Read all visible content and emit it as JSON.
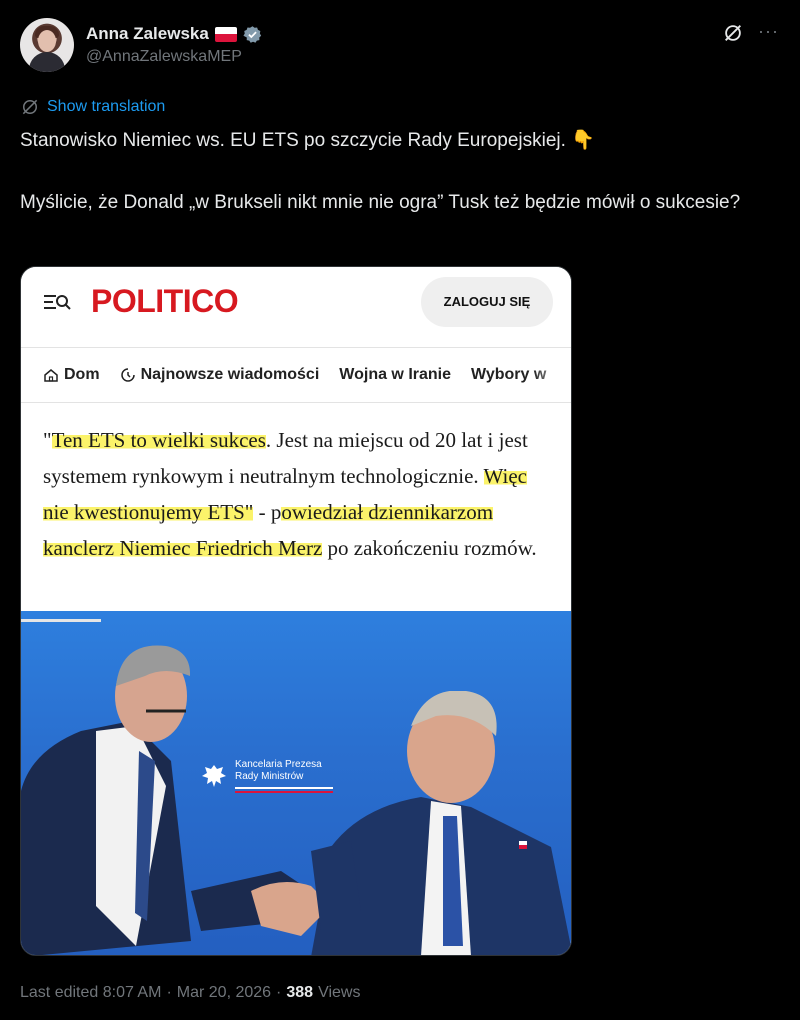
{
  "author": {
    "name": "Anna Zalewska",
    "handle": "@AnnaZalewskaMEP"
  },
  "translate_label": "Show translation",
  "tweet": {
    "line1": "Stanowisko Niemiec ws. EU ETS po szczycie Rady Europejskiej. 👇",
    "line2": "Myślicie, że Donald „w Brukseli nikt mnie nie ogra” Tusk też będzie mówił o sukcesie?"
  },
  "card": {
    "logo": "POLITICO",
    "login_label": "ZALOGUJ SIĘ",
    "nav": [
      "Dom",
      "Najnowsze wiadomości",
      "Wojna w Iranie",
      "Wybory w"
    ],
    "quote": {
      "q0": "\"",
      "h1": "Ten ETS to wielki sukces",
      "t1": ". Jest na miejscu od 20 lat i jest systemem rynkowym i neutralnym technologicznie. ",
      "h2": "Więc nie kwestionujemy ETS\"",
      "t2": " - p",
      "h3": "owiedział dziennikarzom kanclerz Niemiec Friedrich Merz",
      "t3": " po zakończeniu rozmów."
    },
    "backdrop_text": [
      "Kancelaria Prezesa",
      "Rady Ministrów"
    ]
  },
  "footer": {
    "edited": "Last edited 8:07 AM",
    "date": "Mar 20, 2026",
    "views_count": "388",
    "views_label": "Views",
    "sep": "·"
  },
  "colors": {
    "accent": "#1d9bf0",
    "politico_red": "#d71920",
    "highlight": "#fbf36a"
  }
}
